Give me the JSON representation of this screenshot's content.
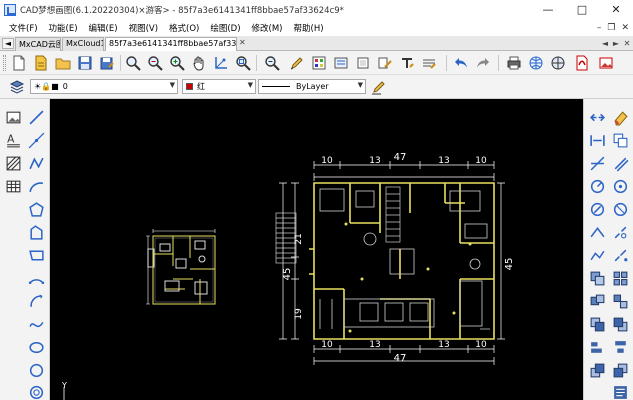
{
  "window": {
    "title": "CAD梦想画图(6.1.20220304)×游客>  -  85f7a3e6141341ff8bbae57af33624c9*",
    "minimize": "—",
    "maximize": "□",
    "close": "✕"
  },
  "menu": {
    "items": [
      "文件(F)",
      "功能(E)",
      "编辑(E)",
      "视图(V)",
      "格式(O)",
      "绘图(D)",
      "修改(M)",
      "帮助(H)"
    ],
    "ctrl_min": "–",
    "ctrl_restore": "❐",
    "ctrl_close": "✕"
  },
  "tabs": {
    "nav_left": "◄",
    "nav_right": "►",
    "close": "✕",
    "items": [
      {
        "label": "MxCAD云图",
        "active": false
      },
      {
        "label": "MxCloud1",
        "active": false
      },
      {
        "label": "85f7a3e6141341ff8bbae57af33624c9*",
        "active": true
      }
    ],
    "tab3_display": "85f7a3e6141341ff8bbae57af33362..."
  },
  "props": {
    "layer_value": "0",
    "color_value": "红",
    "color_hex": "#cc0000",
    "linetype_value": "ByLayer"
  },
  "drawing": {
    "dims_top": [
      "10",
      "13",
      "47",
      "13",
      "10"
    ],
    "dims_bottom": [
      "10",
      "13",
      "47",
      "13",
      "10"
    ],
    "dims_left": [
      "21",
      "45",
      "19"
    ],
    "dims_right": [
      "45"
    ],
    "axis_label": "Y"
  },
  "colors": {
    "canvas_bg": "#000000",
    "wall": "#e8e060",
    "dim_line": "#ffffff",
    "furniture": "#d0d0d0"
  }
}
